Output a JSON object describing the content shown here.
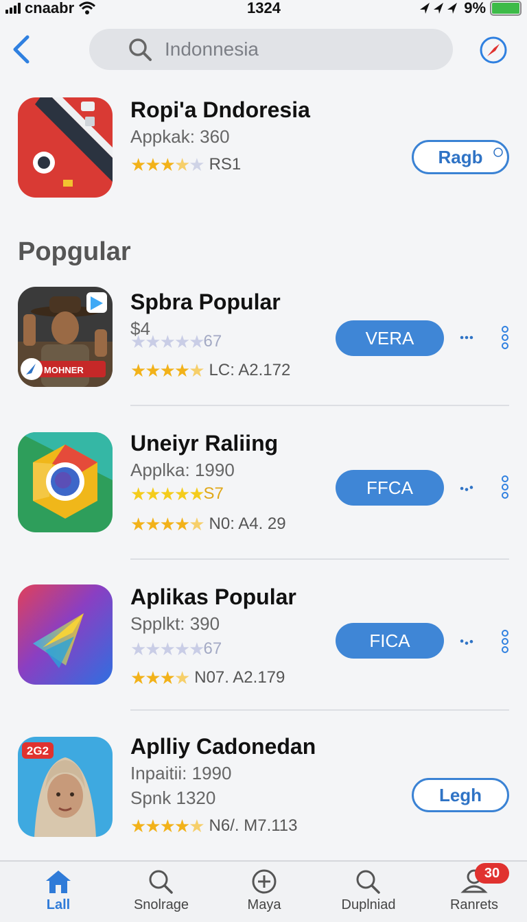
{
  "status_bar": {
    "carrier": "cnaabr",
    "time": "1324",
    "battery": "9%"
  },
  "search": {
    "query": "Indonnesia"
  },
  "featured": {
    "title": "Ropi'a Dndoresia",
    "subtitle": "Appkak: 360",
    "rating_text": "RS1",
    "button": "Ragb"
  },
  "section_title": "Popgular",
  "apps": [
    {
      "title": "Spbra Popular",
      "price": "$4",
      "faded_rating_text": "67",
      "rating_text": "LC: A2.172",
      "button": "VERA"
    },
    {
      "title": "Uneiyr Raliing",
      "subtitle": "Applka: 1990",
      "gold_rating_text": "S7",
      "rating_text": "N0: A4. 29",
      "button": "FFCA"
    },
    {
      "title": "Aplikas Popular",
      "subtitle": "Spplkt: 390",
      "faded_rating_text": "67",
      "rating_text": "N07. A2.179",
      "button": "FICA"
    },
    {
      "title": "Aplliy Cadonedan",
      "subtitle": "Inpaitii: 1990",
      "subtitle2": "Spnk 1320",
      "rating_text": "N6/. M7.113",
      "button": "Legh",
      "icon_badge": "2G2"
    }
  ],
  "app2_icon_text": "MOHNER",
  "tabs": [
    {
      "label": "Lall",
      "icon": "home-icon",
      "active": true
    },
    {
      "label": "Snolrage",
      "icon": "search-icon"
    },
    {
      "label": "Maya",
      "icon": "plus-circle-icon"
    },
    {
      "label": "Duplniad",
      "icon": "search-icon"
    },
    {
      "label": "Ranrets",
      "icon": "person-icon",
      "badge": "30"
    }
  ],
  "colors": {
    "accent": "#3f86d6",
    "star": "#f2b21a",
    "badge": "#e0322f"
  }
}
